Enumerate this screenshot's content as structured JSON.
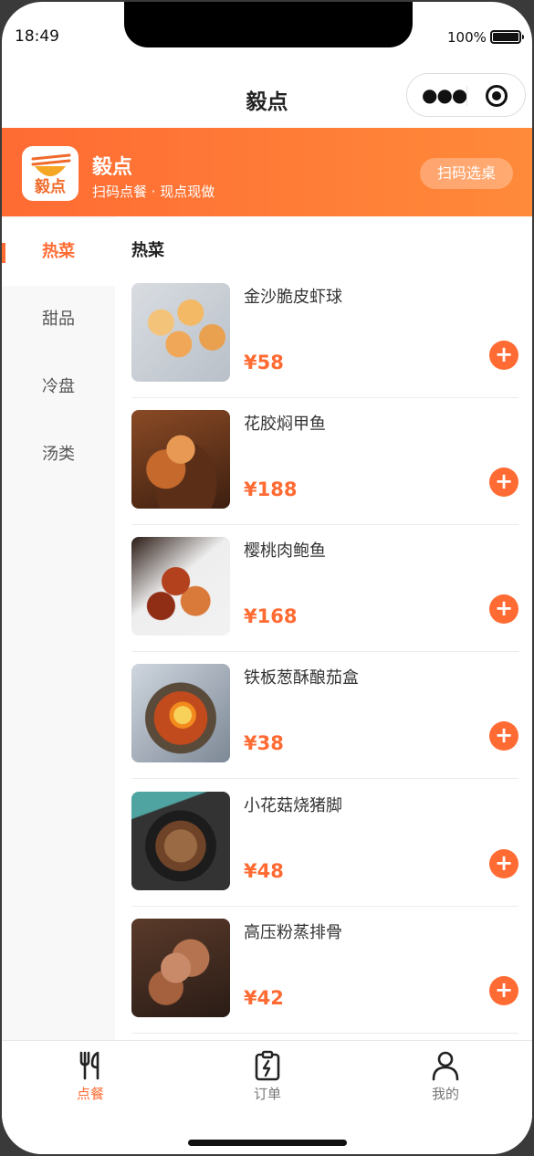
{
  "status": {
    "time": "18:49",
    "battery": "100%",
    "battery_level": 1.0
  },
  "nav": {
    "title": "毅点"
  },
  "store": {
    "logo_text": "毅点",
    "name": "毅点",
    "slogan": "扫码点餐 · 现点现做",
    "scan_button": "扫码选桌"
  },
  "colors": {
    "accent": "#ff6b33",
    "banner_start": "#ff6b33",
    "banner_end": "#ff8a3a"
  },
  "categories": [
    {
      "label": "热菜",
      "active": true
    },
    {
      "label": "甜品",
      "active": false
    },
    {
      "label": "冷盘",
      "active": false
    },
    {
      "label": "汤类",
      "active": false
    }
  ],
  "menu": {
    "section_title": "热菜",
    "add_symbol": "+",
    "items": [
      {
        "name": "金沙脆皮虾球",
        "price": "¥58"
      },
      {
        "name": "花胶焖甲鱼",
        "price": "¥188"
      },
      {
        "name": "樱桃肉鲍鱼",
        "price": "¥168"
      },
      {
        "name": "铁板葱酥酿茄盒",
        "price": "¥38"
      },
      {
        "name": "小花菇烧猪脚",
        "price": "¥48"
      },
      {
        "name": "高压粉蒸排骨",
        "price": "¥42"
      }
    ]
  },
  "tabbar": [
    {
      "label": "点餐",
      "icon": "fork-knife-icon",
      "active": true
    },
    {
      "label": "订单",
      "icon": "clipboard-order-icon",
      "active": false
    },
    {
      "label": "我的",
      "icon": "user-profile-icon",
      "active": false
    }
  ]
}
